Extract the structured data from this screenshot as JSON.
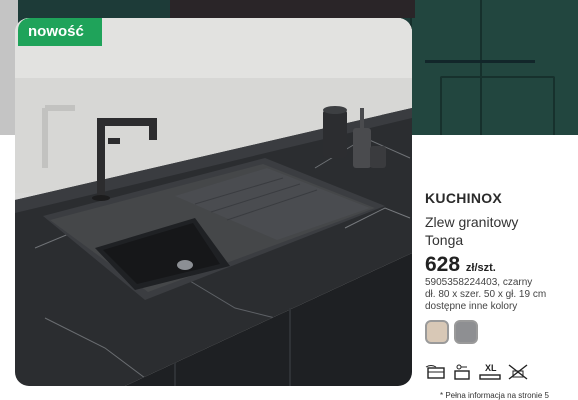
{
  "badge": {
    "label": "nowość"
  },
  "product": {
    "brand": "KUCHINOX",
    "title_line1": "Zlew granitowy",
    "title_line2": "Tonga",
    "price": "628",
    "price_unit": "zł/szt.",
    "spec_line1": "5905358224403, czarny",
    "spec_line2": "dł. 80 x szer. 50 x gł. 19 cm",
    "spec_line3": "dostępne inne kolory"
  },
  "swatches": [
    {
      "name": "beige",
      "color": "#d8c8b6"
    },
    {
      "name": "grey",
      "color": "#8e8f92"
    }
  ],
  "icons": [
    "dishwasher-icon",
    "oven-icon",
    "xl-size-icon",
    "drain-icon"
  ],
  "icon_text": {
    "xl": "XL"
  },
  "footnote": "* Pełna informacja na stronie 5"
}
